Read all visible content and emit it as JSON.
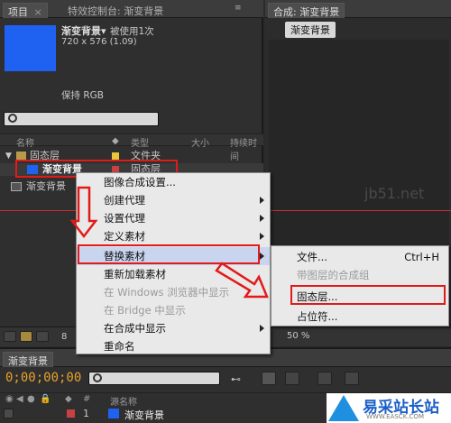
{
  "project_panel": {
    "tab_label": "项目",
    "close_glyph": "×",
    "effects_tab_label": "特效控制台: 渐变背景",
    "item_name": "渐变背景▾",
    "item_usage": "被使用1次",
    "item_dims": "720 x 576 (1.09)",
    "keep_rgb": "保持 RGB",
    "search_placeholder": "",
    "col_name": "名称",
    "col_type": "类型",
    "col_size": "大小",
    "col_duration": "持续时间",
    "rows": [
      {
        "name": "固态层",
        "type": "文件夹"
      },
      {
        "name": "渐变背景",
        "type": "固态层"
      },
      {
        "name": "渐变背景",
        "type": ""
      }
    ],
    "bpc_label": "8"
  },
  "comp_panel": {
    "tab_label": "合成: 渐变背景",
    "chip_label": "渐变背景",
    "zoom_label": "50 %",
    "watermark": "jb51.net"
  },
  "context_menu": {
    "items": [
      {
        "label": "图像合成设置...",
        "disabled": false,
        "submenu": false
      },
      {
        "label": "创建代理",
        "disabled": false,
        "submenu": true
      },
      {
        "label": "设置代理",
        "disabled": false,
        "submenu": true
      },
      {
        "label": "定义素材",
        "disabled": false,
        "submenu": true
      },
      {
        "label": "替换素材",
        "disabled": false,
        "submenu": true
      },
      {
        "label": "重新加载素材",
        "disabled": false,
        "submenu": false
      },
      {
        "label": "在 Windows 浏览器中显示",
        "disabled": true,
        "submenu": false
      },
      {
        "label": "在 Bridge 中显示",
        "disabled": true,
        "submenu": false
      },
      {
        "label": "在合成中显示",
        "disabled": false,
        "submenu": true
      },
      {
        "label": "重命名",
        "disabled": false,
        "submenu": false
      }
    ]
  },
  "submenu": {
    "items": [
      {
        "label": "文件...",
        "shortcut": "Ctrl+H",
        "disabled": false
      },
      {
        "label": "带图层的合成组",
        "shortcut": "",
        "disabled": true
      },
      {
        "label": "固态层...",
        "shortcut": "",
        "disabled": false
      },
      {
        "label": "占位符...",
        "shortcut": "",
        "disabled": false
      }
    ]
  },
  "timeline": {
    "tab_label": "渐变背景",
    "timecode": "0;00;00;00",
    "col_source": "源名称",
    "layer_index": "1",
    "layer_name": "渐变背景"
  },
  "watermark_logo": {
    "title": "易采站长站",
    "url": "WWW.EASCK.COM"
  },
  "colors": {
    "accent_blue": "#1f62f2",
    "annotation_red": "#e21a1a",
    "timecode_orange": "#e8a32a"
  }
}
